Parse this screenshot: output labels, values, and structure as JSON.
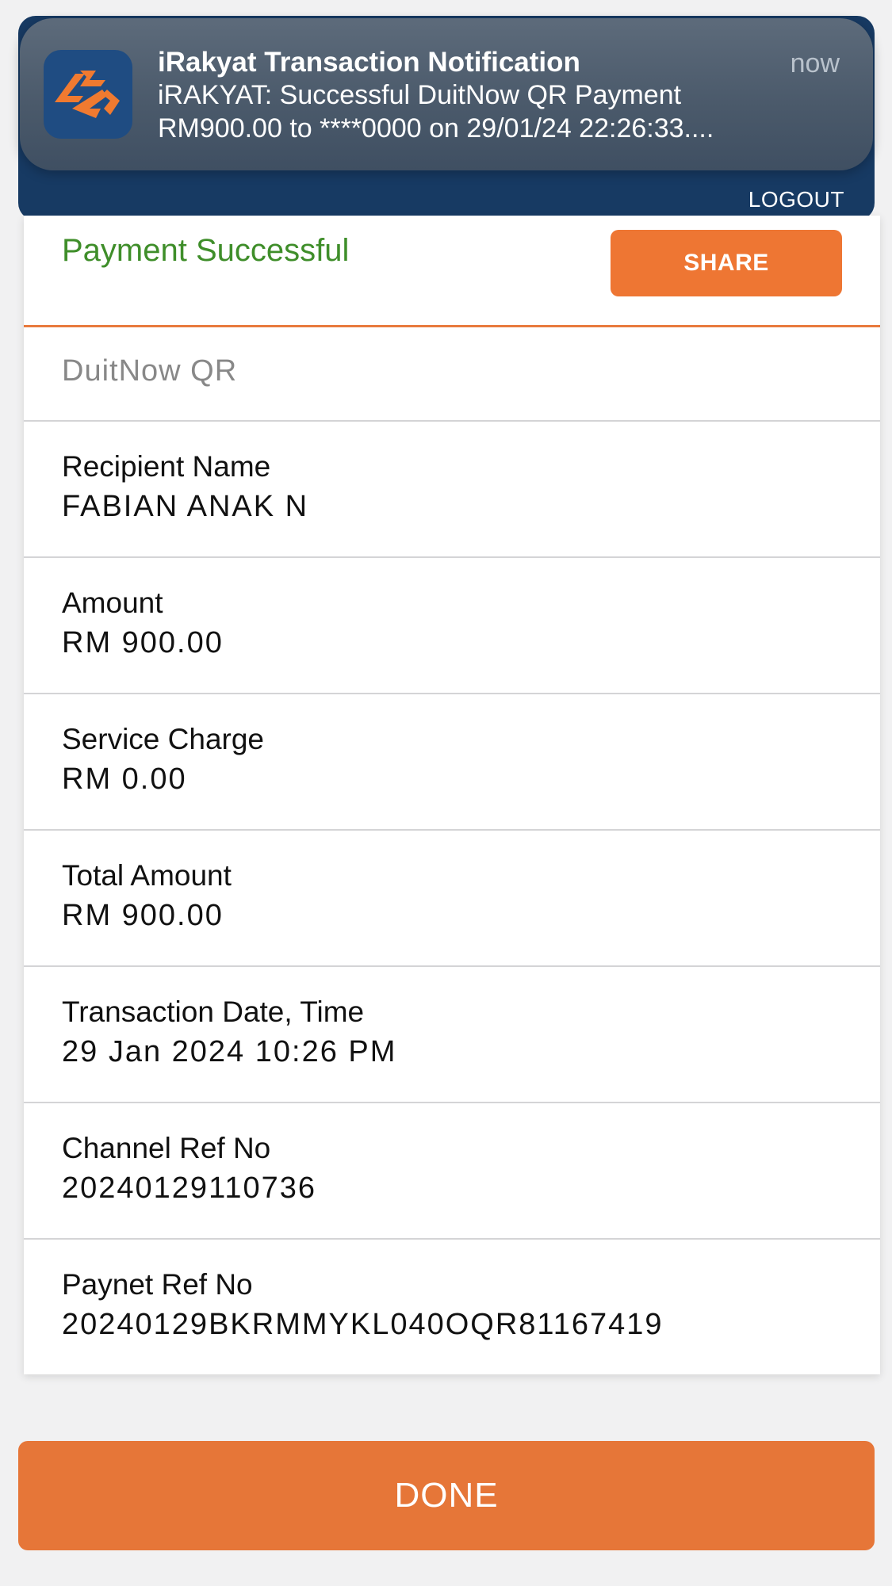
{
  "notification": {
    "app_icon": "irakyat-logo-icon",
    "title": "iRakyat Transaction Notification",
    "time": "now",
    "line1": "iRAKYAT: Successful DuitNow QR Payment",
    "line2": "RM900.00 to ****0000 on 29/01/24 22:26:33...."
  },
  "header": {
    "logout_label": "LOGOUT"
  },
  "receipt": {
    "status": "Payment Successful",
    "share_label": "SHARE",
    "method": "DuitNow QR",
    "rows": [
      {
        "label": "Recipient Name",
        "value": "FABIAN ANAK N"
      },
      {
        "label": "Amount",
        "value": "RM 900.00"
      },
      {
        "label": "Service Charge",
        "value": "RM 0.00"
      },
      {
        "label": "Total Amount",
        "value": "RM 900.00"
      },
      {
        "label": "Transaction Date, Time",
        "value": "29 Jan 2024 10:26 PM"
      },
      {
        "label": "Channel Ref No",
        "value": "20240129110736"
      },
      {
        "label": "Paynet Ref No",
        "value": "20240129BKRMMYKL040OQR81167419"
      }
    ]
  },
  "done_label": "DONE",
  "colors": {
    "accent_orange": "#ee7633",
    "header_navy": "#173a63",
    "success_green": "#3f8e2a"
  }
}
